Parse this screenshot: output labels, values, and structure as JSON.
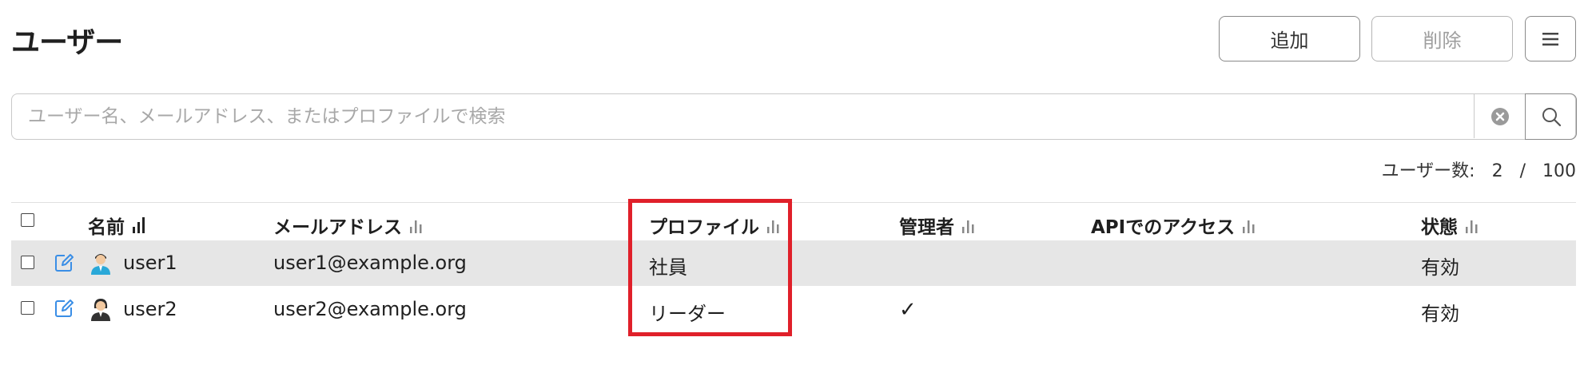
{
  "page": {
    "title": "ユーザー"
  },
  "toolbar": {
    "add_label": "追加",
    "delete_label": "削除",
    "menu_icon": "menu-icon"
  },
  "search": {
    "placeholder": "ユーザー名、メールアドレス、またはプロファイルで検索",
    "value": ""
  },
  "user_count": {
    "label": "ユーザー数:",
    "current": "2",
    "separator": "/",
    "total": "100"
  },
  "table": {
    "headers": [
      "名前",
      "メールアドレス",
      "プロファイル",
      "管理者",
      "APIでのアクセス",
      "状態"
    ],
    "rows": [
      {
        "name": "user1",
        "email": "user1@example.org",
        "profile": "社員",
        "admin": "",
        "api_access": "",
        "status": "有効",
        "selected": true,
        "avatar": "male-user-icon"
      },
      {
        "name": "user2",
        "email": "user2@example.org",
        "profile": "リーダー",
        "admin": "✓",
        "api_access": "",
        "status": "有効",
        "selected": false,
        "avatar": "female-user-icon"
      }
    ]
  },
  "colors": {
    "highlight": "#e0202a",
    "accent": "#3a8ee6",
    "row_selected": "#e6e6e6"
  }
}
